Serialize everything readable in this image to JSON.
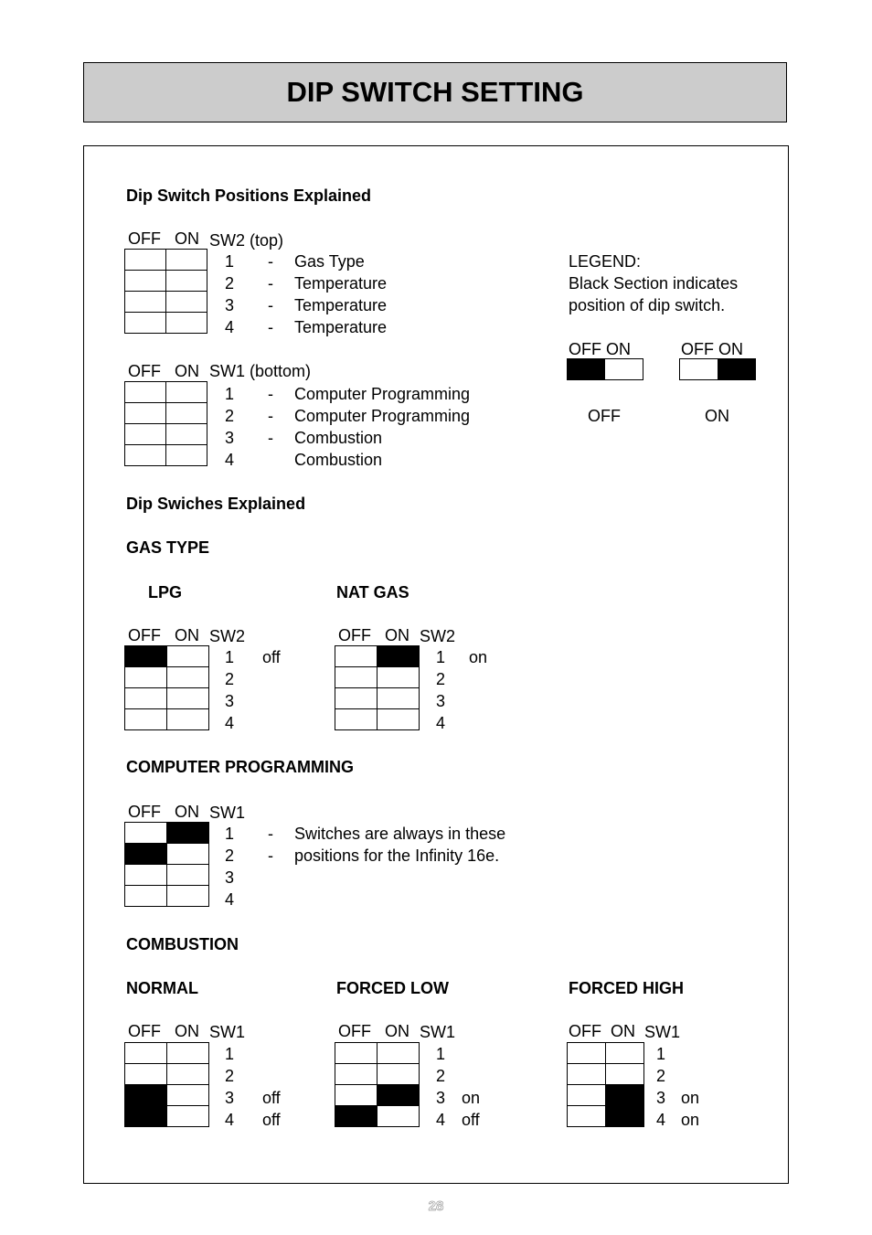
{
  "title": "DIP SWITCH SETTING",
  "page_number": "28",
  "positions": {
    "heading": "Dip Switch Positions Explained",
    "col_off": "OFF",
    "col_on": "ON",
    "sw2": {
      "label": "SW2 (top)",
      "rows": [
        {
          "num": "1",
          "dash": "-",
          "desc": "Gas Type"
        },
        {
          "num": "2",
          "dash": "-",
          "desc": "Temperature"
        },
        {
          "num": "3",
          "dash": "-",
          "desc": "Temperature"
        },
        {
          "num": "4",
          "dash": "-",
          "desc": "Temperature"
        }
      ]
    },
    "sw1": {
      "label": "SW1 (bottom)",
      "rows": [
        {
          "num": "1",
          "dash": "-",
          "desc": "Computer Programming"
        },
        {
          "num": "2",
          "dash": "-",
          "desc": "Computer Programming"
        },
        {
          "num": "3",
          "dash": "-",
          "desc": "Combustion"
        },
        {
          "num": "4",
          "dash": "",
          "desc": "Combustion"
        }
      ]
    }
  },
  "legend": {
    "title": "LEGEND:",
    "line1": "Black Section indicates",
    "line2": "position of dip switch.",
    "off_example": {
      "header": "OFF ON",
      "state": "off",
      "caption": "OFF"
    },
    "on_example": {
      "header": "OFF ON",
      "state": "on",
      "caption": "ON"
    }
  },
  "explained": {
    "heading": "Dip Swiches Explained",
    "gas_type": {
      "heading": "GAS TYPE",
      "lpg": {
        "title": "LPG",
        "header": {
          "off": "OFF",
          "on": "ON",
          "sw": "SW2"
        },
        "rows": [
          {
            "num": "1",
            "state": "off",
            "note": "off"
          },
          {
            "num": "2",
            "state": "none",
            "note": ""
          },
          {
            "num": "3",
            "state": "none",
            "note": ""
          },
          {
            "num": "4",
            "state": "none",
            "note": ""
          }
        ]
      },
      "nat_gas": {
        "title": "NAT GAS",
        "header": {
          "off": "OFF",
          "on": "ON",
          "sw": "SW2"
        },
        "rows": [
          {
            "num": "1",
            "state": "on",
            "note": "on"
          },
          {
            "num": "2",
            "state": "none",
            "note": ""
          },
          {
            "num": "3",
            "state": "none",
            "note": ""
          },
          {
            "num": "4",
            "state": "none",
            "note": ""
          }
        ]
      }
    },
    "computer_programming": {
      "heading": "COMPUTER PROGRAMMING",
      "header": {
        "off": "OFF",
        "on": "ON",
        "sw": "SW1"
      },
      "rows": [
        {
          "num": "1",
          "state": "on",
          "dash": "-",
          "note": "Switches are always in these"
        },
        {
          "num": "2",
          "state": "off",
          "dash": "-",
          "note": "positions for the Infinity 16e."
        },
        {
          "num": "3",
          "state": "none",
          "dash": "",
          "note": ""
        },
        {
          "num": "4",
          "state": "none",
          "dash": "",
          "note": ""
        }
      ]
    },
    "combustion": {
      "heading": "COMBUSTION",
      "normal": {
        "title": "NORMAL",
        "header": {
          "off": "OFF",
          "on": "ON",
          "sw": "SW1"
        },
        "rows": [
          {
            "num": "1",
            "state": "none",
            "note": ""
          },
          {
            "num": "2",
            "state": "none",
            "note": ""
          },
          {
            "num": "3",
            "state": "off",
            "note": "off"
          },
          {
            "num": "4",
            "state": "off",
            "note": "off"
          }
        ]
      },
      "forced_low": {
        "title": "FORCED LOW",
        "header": {
          "off": "OFF",
          "on": "ON",
          "sw": "SW1"
        },
        "rows": [
          {
            "num": "1",
            "state": "none",
            "note": ""
          },
          {
            "num": "2",
            "state": "none",
            "note": ""
          },
          {
            "num": "3",
            "state": "on",
            "note": "on"
          },
          {
            "num": "4",
            "state": "off",
            "note": "off"
          }
        ]
      },
      "forced_high": {
        "title": "FORCED HIGH",
        "header": {
          "off": "OFF",
          "on": "ON",
          "sw": "SW1"
        },
        "rows": [
          {
            "num": "1",
            "state": "none",
            "note": ""
          },
          {
            "num": "2",
            "state": "none",
            "note": ""
          },
          {
            "num": "3",
            "state": "on",
            "note": "on"
          },
          {
            "num": "4",
            "state": "on",
            "note": "on"
          }
        ]
      }
    }
  }
}
